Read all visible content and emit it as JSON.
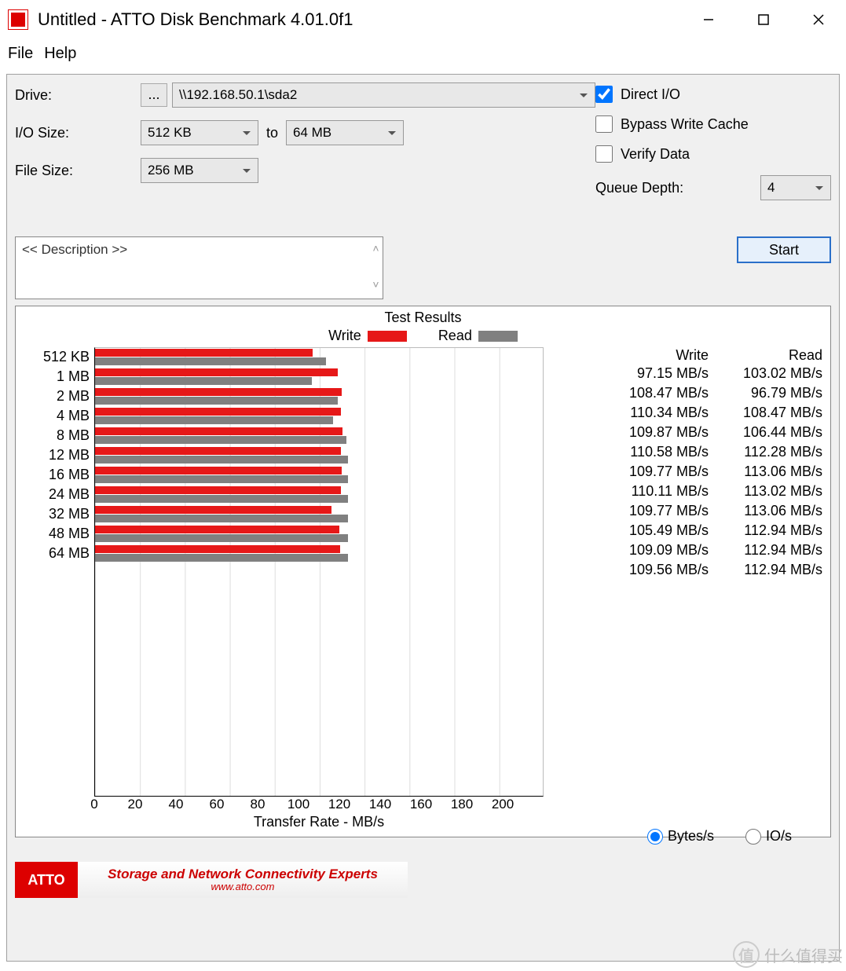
{
  "window": {
    "title": "Untitled - ATTO Disk Benchmark 4.01.0f1"
  },
  "menu": {
    "file": "File",
    "help": "Help"
  },
  "form": {
    "drive_label": "Drive:",
    "drive_value": "\\\\192.168.50.1\\sda2",
    "io_size_label": "I/O Size:",
    "io_from": "512 KB",
    "io_to_label": "to",
    "io_to": "64 MB",
    "file_size_label": "File Size:",
    "file_size": "256 MB",
    "direct_io": "Direct I/O",
    "bypass": "Bypass Write Cache",
    "verify": "Verify Data",
    "queue_label": "Queue Depth:",
    "queue_value": "4",
    "desc_placeholder": "<< Description >>",
    "start": "Start",
    "browse": "..."
  },
  "chart_header": {
    "title": "Test Results",
    "write": "Write",
    "read": "Read",
    "xlabel": "Transfer Rate - MB/s"
  },
  "results_head": {
    "write": "Write",
    "read": "Read"
  },
  "unit": "MB/s",
  "radio": {
    "bytes": "Bytes/s",
    "io": "IO/s"
  },
  "banner": {
    "logo": "ATTO",
    "line1": "Storage and Network Connectivity Experts",
    "line2": "www.atto.com"
  },
  "watermark": "什么值得买",
  "chart_data": {
    "type": "bar",
    "orientation": "horizontal",
    "xlabel": "Transfer Rate - MB/s",
    "xlim": [
      0,
      200
    ],
    "xticks": [
      0,
      20,
      40,
      60,
      80,
      100,
      120,
      140,
      160,
      180,
      200
    ],
    "series_names": [
      "Write",
      "Read"
    ],
    "categories": [
      "512 KB",
      "1 MB",
      "2 MB",
      "4 MB",
      "8 MB",
      "12 MB",
      "16 MB",
      "24 MB",
      "32 MB",
      "48 MB",
      "64 MB"
    ],
    "series": [
      {
        "name": "Write",
        "color": "#e61818",
        "values": [
          97.15,
          108.47,
          110.34,
          109.87,
          110.58,
          109.77,
          110.11,
          109.77,
          105.49,
          109.09,
          109.56
        ]
      },
      {
        "name": "Read",
        "color": "#808080",
        "values": [
          103.02,
          96.79,
          108.47,
          106.44,
          112.28,
          113.06,
          113.02,
          113.06,
          112.94,
          112.94,
          112.94
        ]
      }
    ]
  }
}
